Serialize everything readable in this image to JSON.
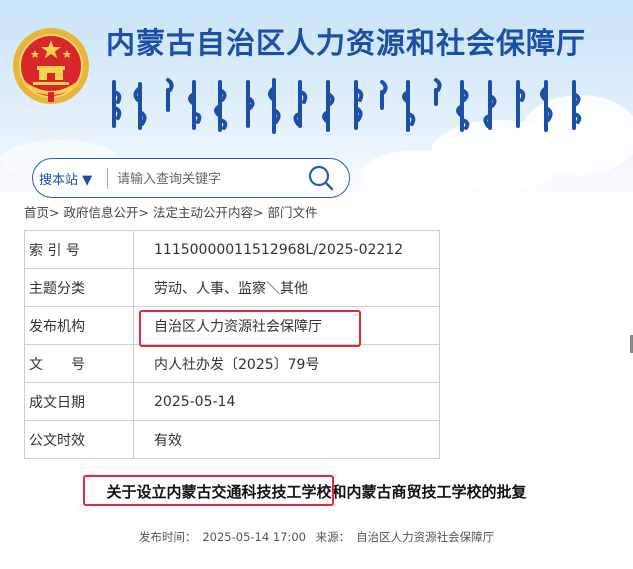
{
  "header": {
    "site_title": "内蒙古自治区人力资源和社会保障厅",
    "emblem_icon": "national-emblem-icon",
    "mongolian_script_icon": "mongolian-title-script"
  },
  "search": {
    "site_select": "搜本站 ▼",
    "placeholder": "请输入查询关键字",
    "button_icon": "search-icon"
  },
  "breadcrumb": {
    "items": [
      "首页",
      "政府信息公开",
      "法定主动公开内容",
      "部门文件"
    ],
    "separator": ">"
  },
  "meta": {
    "rows": [
      {
        "key": "索 引 号",
        "value": "11150000011512968L/2025-02212"
      },
      {
        "key": "主题分类",
        "value": "劳动、人事、监察＼其他"
      },
      {
        "key": "发布机构",
        "value": "自治区人力资源社会保障厅"
      },
      {
        "key": "文　　号",
        "value": "内人社办发〔2025〕79号"
      },
      {
        "key": "成文日期",
        "value": "2025-05-14"
      },
      {
        "key": "公文时效",
        "value": "有效"
      }
    ]
  },
  "document": {
    "title": "关于设立内蒙古交通科技技工学校和内蒙古商贸技工学校的批复",
    "publish_time_label": "发布时间：",
    "publish_time": "2025-05-14 17:00",
    "source_label": "来源：",
    "source": "自治区人力资源社会保障厅"
  },
  "colors": {
    "title_blue": "#1b4fa8",
    "highlight_red": "#e8272e"
  }
}
